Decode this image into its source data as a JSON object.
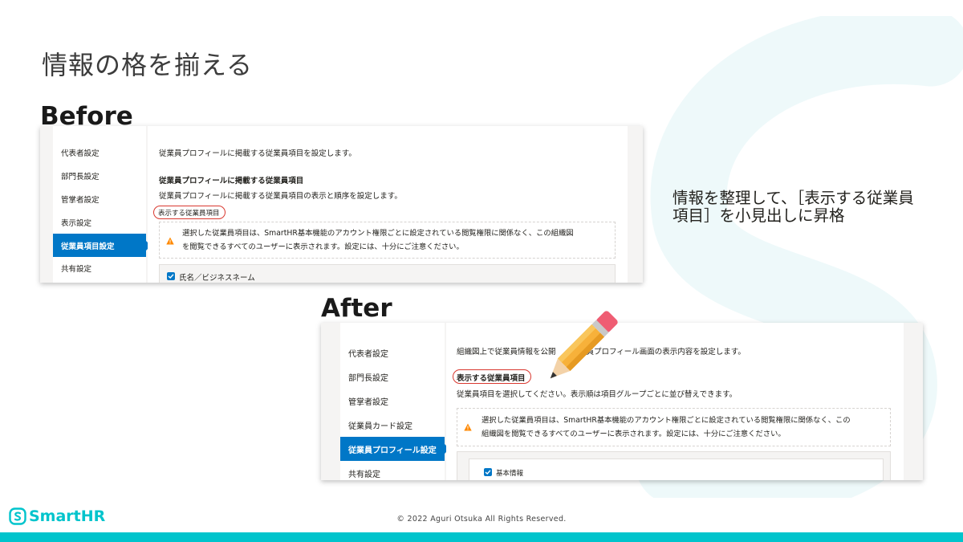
{
  "slide": {
    "title": "情報の格を揃える",
    "before_label": "Before",
    "after_label": "After",
    "note": "情報を整理して、［表示する従業員項目］を小見出しに昇格",
    "copyright": "© 2022 Aguri Otsuka All Rights Reserved.",
    "brand_name": "SmartHR",
    "brand_color": "#00c4cc",
    "accent_color": "#0077c7",
    "highlight_color": "#d9382f"
  },
  "before": {
    "sidebar": [
      "代表者設定",
      "部門長設定",
      "管掌者設定",
      "表示設定",
      "従業員項目設定",
      "共有設定"
    ],
    "active_index": 4,
    "intro": "従業員プロフィールに掲載する従業員項目を設定します。",
    "heading": "従業員プロフィールに掲載する従業員項目",
    "heading_desc": "従業員プロフィールに掲載する従業員項目の表示と順序を設定します。",
    "highlight_label": "表示する従業員項目",
    "warning_line1": "選択した従業員項目は、SmartHR基本機能のアカウント権限ごとに設定されている閲覧権限に関係なく、この組織図",
    "warning_line2": "を閲覧できるすべてのユーザーに表示されます。設定には、十分にご注意ください。",
    "checkbox_label": "氏名／ビジネスネーム"
  },
  "after": {
    "sidebar": [
      "代表者設定",
      "部門長設定",
      "管掌者設定",
      "従業員カード設定",
      "従業員プロフィール設定",
      "共有設定"
    ],
    "active_index": 4,
    "intro": "組織図上で従業員情報を公開　　従業員プロフィール画面の表示内容を設定します。",
    "heading": "表示する従業員項目",
    "heading_desc": "従業員項目を選択してください。表示順は項目グループごとに並び替えできます。",
    "warning_line1": "選択した従業員項目は、SmartHR基本機能のアカウント権限ごとに設定されている閲覧権限に関係なく、この",
    "warning_line2": "組織図を閲覧できるすべてのユーザーに表示されます。設定には、十分にご注意ください。",
    "checkbox_label": "基本情報"
  }
}
